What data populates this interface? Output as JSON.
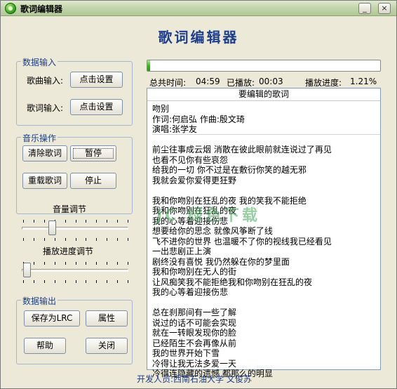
{
  "window": {
    "title": "歌词编辑器",
    "controls": {
      "minimize": "_",
      "close": "×"
    }
  },
  "header": {
    "title": "歌词编辑器"
  },
  "data_input": {
    "legend": "数据输入",
    "song_label": "歌曲输入:",
    "song_button": "点击设置",
    "lyric_label": "歌词输入:",
    "lyric_button": "点击设置"
  },
  "music_ops": {
    "legend": "音乐操作",
    "clear": "清除歌词",
    "pause": "暂停",
    "reload": "重载歌词",
    "stop": "停止"
  },
  "sliders": {
    "volume_label": "音量调节",
    "volume_level": 0.27,
    "progress_label": "播放进度调节",
    "progress_level": 0.0121
  },
  "data_output": {
    "legend": "数据输出",
    "save_lrc": "保存为LRC",
    "properties": "属性",
    "help": "帮助",
    "close": "关闭"
  },
  "player": {
    "total_time_label": "总共时间:",
    "total_time": "04:59",
    "played_label": "已播放:",
    "played": "00:03",
    "progress_label": "播放进度:",
    "progress_text": "1.21%",
    "progress_fraction": 0.0121
  },
  "lyrics": {
    "header": "要编辑的歌词",
    "lines": [
      "吻别",
      "作词:何启弘 作曲:殷文琦",
      "演唱:张学友",
      "",
      "前尘往事成云烟 消散在彼此眼前就连说过了再见",
      "也看不见你有些哀怨",
      "给我的一切 你不过是在敷衍你笑的越无邪",
      "我就会爱你爱得更狂野",
      "",
      "我和你吻别在狂乱的夜 我的笑我不能拒绝",
      "我和你吻别在狂乱的夜",
      "我的心等着迎接伤悲",
      "想要给你的思念 就像风筝断了线",
      "飞不进你的世界 也温暖不了你的视线我已经看见",
      "一出悲剧正上演",
      "剧终没有喜悦 我仍然躲在你的梦里面",
      "我和你吻别在无人的街",
      "让风痴笑我不能拒绝我和你吻别在狂乱的夜",
      "我的心等着迎接伤悲",
      "",
      "总在刹那间有一些了解",
      "说过的话不可能会实现",
      "就在一转眼发现你的脸",
      "已经陌生不会再像从前",
      "我的世界开始下雪",
      "冷得让我无法多爱一天",
      "冷得连隐藏的遗憾 都那么的明显"
    ]
  },
  "watermark": "JC 绿色下载",
  "footer": "开发人员:西南石油大学  文俊苏",
  "colors": {
    "accent": "#1f3f8c",
    "progress": "#38b21b",
    "titlebar": "#c4d6ab",
    "background": "#ece9d8"
  }
}
